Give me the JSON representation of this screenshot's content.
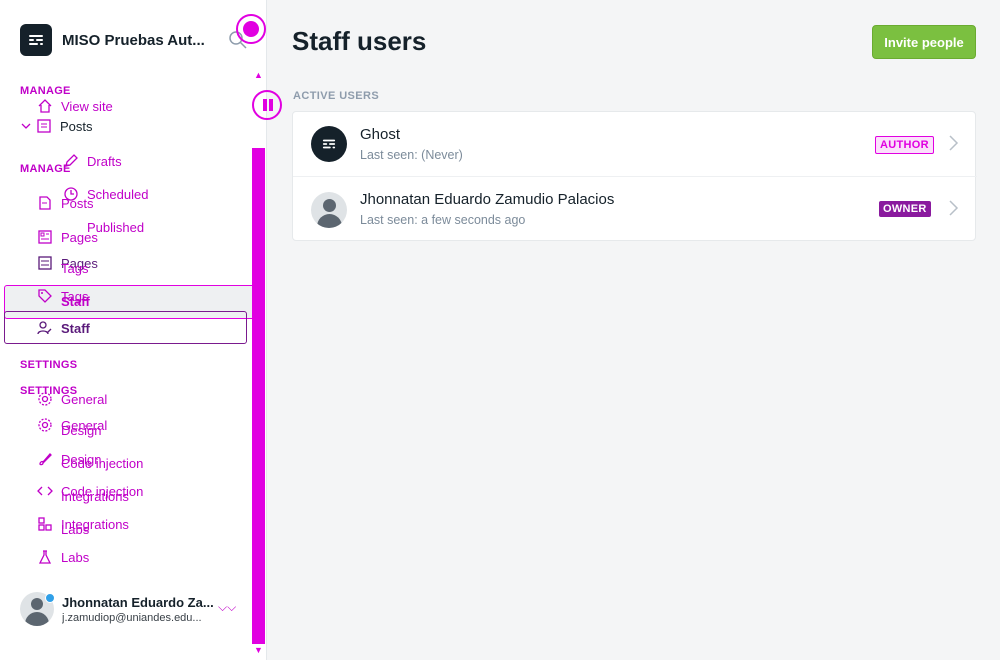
{
  "sidebar": {
    "site_name": "MISO Pruebas Aut...",
    "primary_nav": [
      {
        "label": "View site"
      },
      {
        "label": "Posts"
      },
      {
        "label": "Drafts"
      },
      {
        "label": "Scheduled"
      },
      {
        "label": "Published"
      }
    ],
    "manage_heading": "MANAGE",
    "manage_items": [
      {
        "label": "Posts"
      },
      {
        "label": "Pages"
      },
      {
        "label": "Tags"
      },
      {
        "label": "Staff"
      }
    ],
    "settings_heading": "SETTINGS",
    "settings_items": [
      {
        "label": "General"
      },
      {
        "label": "Design"
      },
      {
        "label": "Code injection"
      },
      {
        "label": "Integrations"
      },
      {
        "label": "Labs"
      }
    ],
    "user": {
      "name": "Jhonnatan Eduardo Za...",
      "email": "j.zamudiop@uniandes.edu..."
    }
  },
  "main": {
    "title": "Staff users",
    "invite_label": "Invite people",
    "section_label": "ACTIVE USERS",
    "users": [
      {
        "name": "Ghost",
        "last_seen": "Last seen: (Never)",
        "role": "AUTHOR"
      },
      {
        "name": "Jhonnatan Eduardo Zamudio Palacios",
        "last_seen": "Last seen: a few seconds ago",
        "role": "OWNER"
      }
    ]
  },
  "colors": {
    "accent_green": "#7bc040",
    "overlay_magenta": "#e100e1",
    "owner_purple": "#8a1a9e"
  }
}
